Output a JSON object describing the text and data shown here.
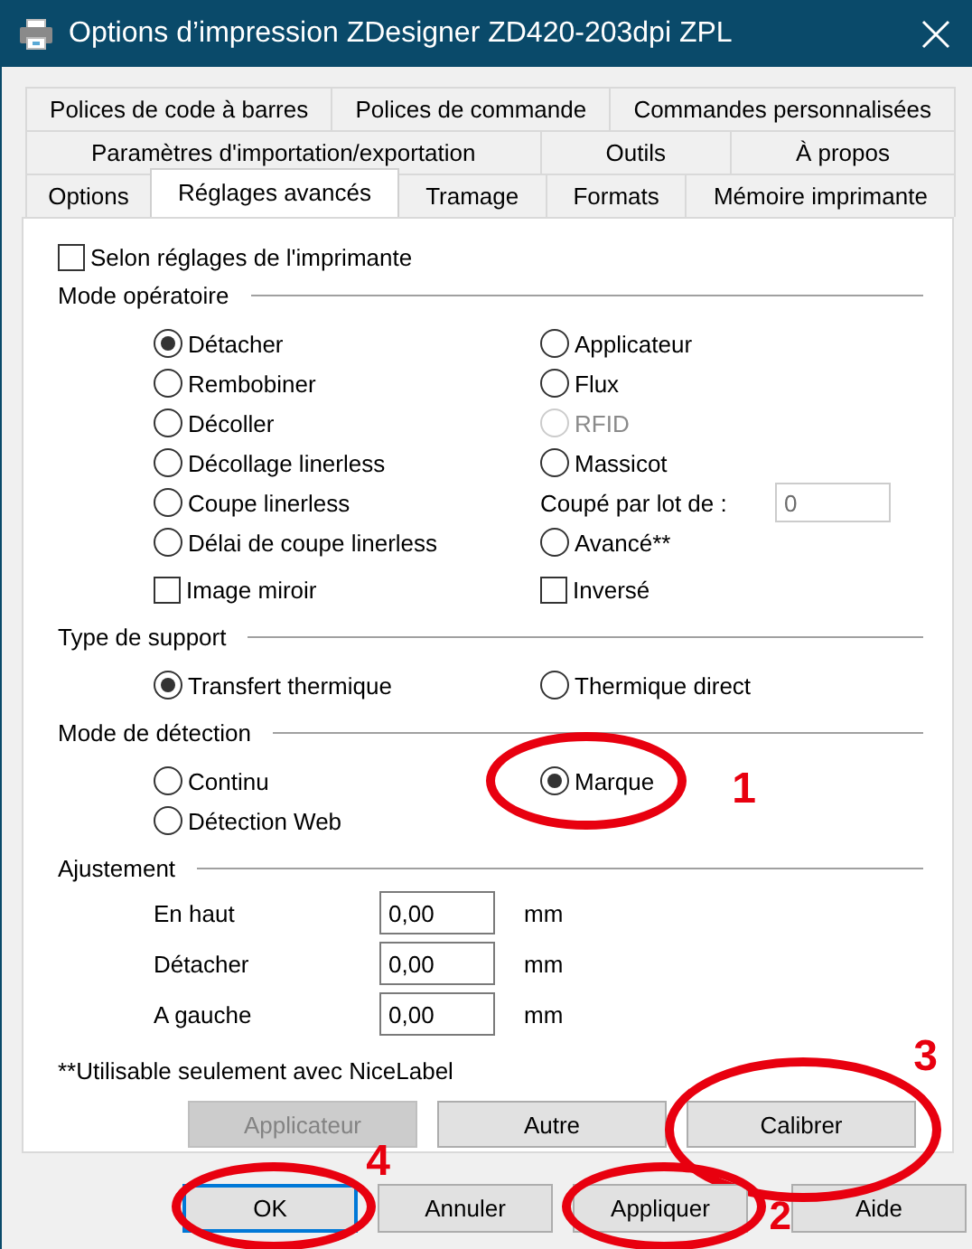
{
  "window": {
    "title": "Options d’impression ZDesigner ZD420-203dpi ZPL"
  },
  "tab_rows": [
    [
      {
        "label": "Polices de code à barres",
        "selected": false
      },
      {
        "label": "Polices de commande",
        "selected": false
      },
      {
        "label": "Commandes personnalisées",
        "selected": false
      }
    ],
    [
      {
        "label": "Paramètres d'importation/exportation",
        "selected": false
      },
      {
        "label": "Outils",
        "selected": false
      },
      {
        "label": "À propos",
        "selected": false
      }
    ],
    [
      {
        "label": "Options",
        "selected": false
      },
      {
        "label": "Réglages avancés",
        "selected": true
      },
      {
        "label": "Tramage",
        "selected": false
      },
      {
        "label": "Formats",
        "selected": false
      },
      {
        "label": "Mémoire imprimante",
        "selected": false
      }
    ]
  ],
  "printer_settings": {
    "label": "Selon réglages de l'imprimante",
    "checked": false
  },
  "sections": [
    {
      "title": "Mode opératoire",
      "columns": [
        [
          {
            "kind": "radio",
            "label": "Détacher",
            "selected": true
          },
          {
            "kind": "radio",
            "label": "Rembobiner",
            "selected": false
          },
          {
            "kind": "radio",
            "label": "Décoller",
            "selected": false
          },
          {
            "kind": "radio",
            "label": "Décollage linerless",
            "selected": false
          },
          {
            "kind": "radio",
            "label": "Coupe linerless",
            "selected": false
          },
          {
            "kind": "radio",
            "label": "Délai de coupe linerless",
            "selected": false
          },
          {
            "kind": "checkbox",
            "label": "Image miroir",
            "checked": false
          }
        ],
        [
          {
            "kind": "radio",
            "label": "Applicateur",
            "selected": false
          },
          {
            "kind": "radio",
            "label": "Flux",
            "selected": false
          },
          {
            "kind": "radio",
            "label": "RFID",
            "selected": false,
            "disabled": true
          },
          {
            "kind": "radio",
            "label": "Massicot",
            "selected": false
          },
          {
            "kind": "field",
            "label": "Coupé par lot de :",
            "value": "0",
            "disabled": true
          },
          {
            "kind": "radio",
            "label": "Avancé**",
            "selected": false
          },
          {
            "kind": "checkbox",
            "label": "Inversé",
            "checked": false
          }
        ]
      ]
    },
    {
      "title": "Type de support",
      "columns": [
        [
          {
            "kind": "radio",
            "label": "Transfert thermique",
            "selected": true
          }
        ],
        [
          {
            "kind": "radio",
            "label": "Thermique direct",
            "selected": false
          }
        ]
      ]
    },
    {
      "title": "Mode de détection",
      "columns": [
        [
          {
            "kind": "radio",
            "label": "Continu",
            "selected": false
          },
          {
            "kind": "radio",
            "label": "Détection Web",
            "selected": false
          }
        ],
        [
          {
            "kind": "radio",
            "label": "Marque",
            "selected": true,
            "annotation": {
              "number": "1"
            }
          }
        ]
      ]
    }
  ],
  "adjustment": {
    "title": "Ajustement",
    "rows": [
      {
        "label": "En haut",
        "value": "0,00",
        "unit": "mm"
      },
      {
        "label": "Détacher",
        "value": "0,00",
        "unit": "mm"
      },
      {
        "label": "A gauche",
        "value": "0,00",
        "unit": "mm"
      }
    ]
  },
  "footnote": "**Utilisable seulement avec NiceLabel",
  "panel_buttons": [
    {
      "label": "Applicateur",
      "disabled": true
    },
    {
      "label": "Autre",
      "disabled": false
    },
    {
      "label": "Calibrer",
      "disabled": false,
      "annotation": {
        "number": "3"
      }
    }
  ],
  "dialog_buttons": [
    {
      "label": "OK",
      "default": true,
      "annotation": {
        "number": "4"
      }
    },
    {
      "label": "Annuler",
      "default": false
    },
    {
      "label": "Appliquer",
      "default": false,
      "annotation": {
        "number": "2"
      }
    },
    {
      "label": "Aide",
      "default": false
    }
  ]
}
